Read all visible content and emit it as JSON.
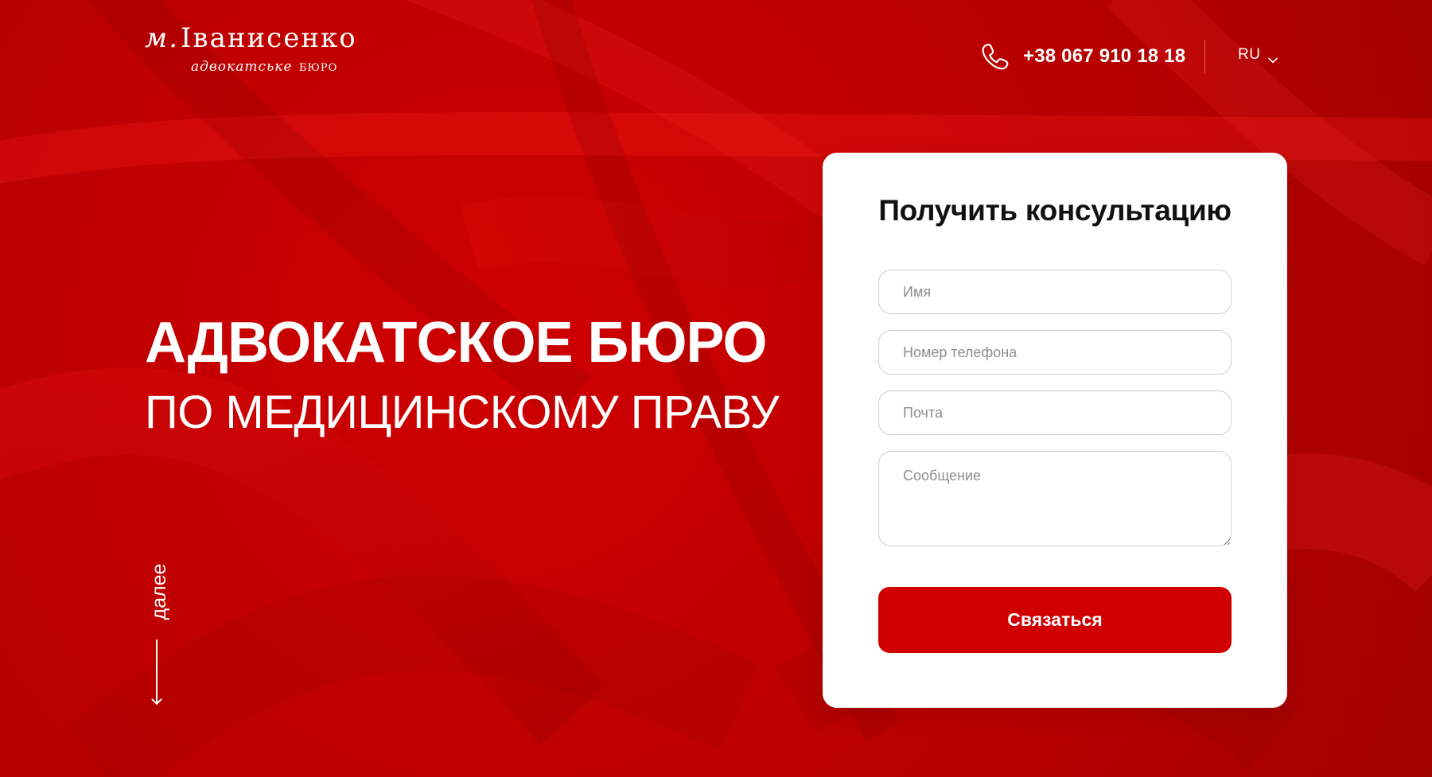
{
  "colors": {
    "background_red": "#c40000",
    "button_red": "#d00000",
    "card_white": "#ffffff",
    "heading_dark": "#111111",
    "placeholder_gray": "#8d8d8d"
  },
  "header": {
    "logo": {
      "initial": "м.",
      "name": "Іванисенко",
      "subtitle_italic": "адвокатське",
      "subtitle_caps": "БЮРО"
    },
    "phone": {
      "icon": "phone-icon",
      "number": "+38 067 910 18 18"
    },
    "language": {
      "selected": "RU",
      "icon": "chevron-down-icon"
    }
  },
  "hero": {
    "title": "АДВОКАТСКОЕ БЮРО",
    "subtitle": "ПО МЕДИЦИНСКОМУ ПРАВУ",
    "scroll_label": "далее",
    "scroll_icon": "arrow-down-icon"
  },
  "form": {
    "title": "Получить консультацию",
    "fields": {
      "name_placeholder": "Имя",
      "phone_placeholder": "Номер телефона",
      "email_placeholder": "Почта",
      "message_placeholder": "Сообщение"
    },
    "submit_label": "Связаться"
  }
}
